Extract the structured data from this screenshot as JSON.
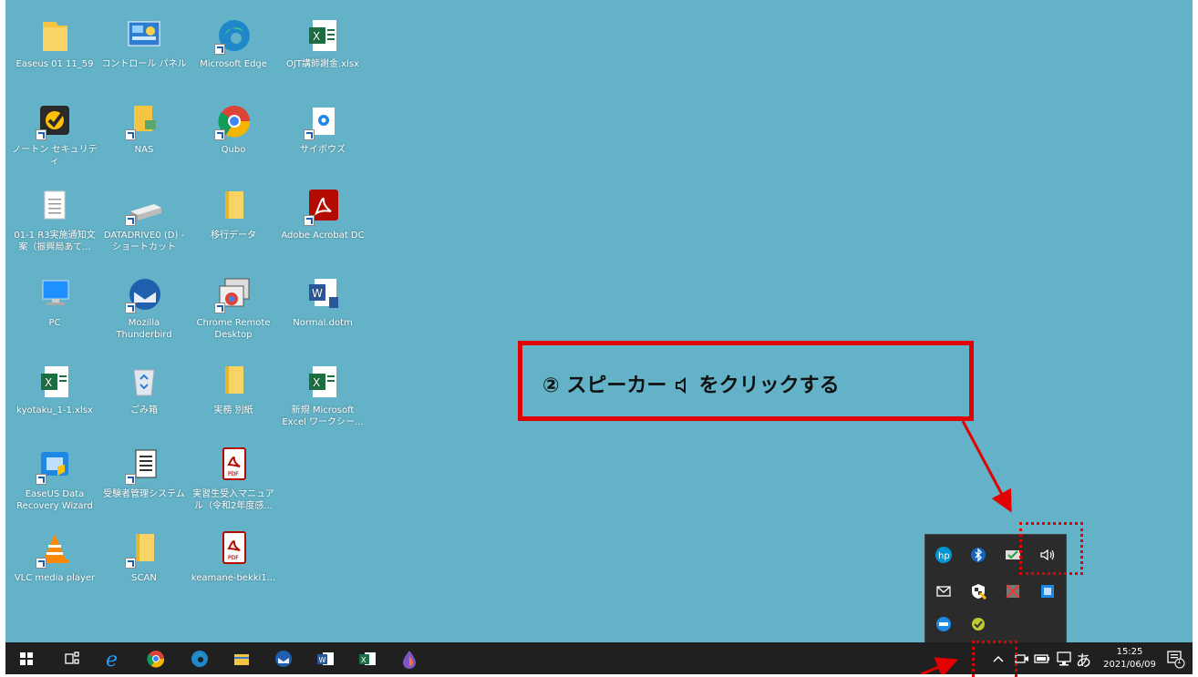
{
  "desktop": {
    "icons": [
      {
        "label": "Easeus 01 11_59"
      },
      {
        "label": "コントロール パネル"
      },
      {
        "label": "Microsoft Edge"
      },
      {
        "label": "OJT講師謝金.xlsx"
      },
      {
        "label": "ノートン セキュリティ"
      },
      {
        "label": "NAS"
      },
      {
        "label": "Qubo"
      },
      {
        "label": "サイボウズ"
      },
      {
        "label": "01-1 R3実施通知文案（振興局あて..."
      },
      {
        "label": "DATADRIVE0 (D) - ショートカット"
      },
      {
        "label": "移行データ"
      },
      {
        "label": "Adobe Acrobat DC"
      },
      {
        "label": "PC"
      },
      {
        "label": "Mozilla Thunderbird"
      },
      {
        "label": "Chrome Remote Desktop"
      },
      {
        "label": "Normal.dotm"
      },
      {
        "label": "kyotaku_1-1.xlsx"
      },
      {
        "label": "ごみ箱"
      },
      {
        "label": "実務 別紙"
      },
      {
        "label": "新規 Microsoft Excel ワークシー..."
      },
      {
        "label": "EaseUS Data Recovery Wizard"
      },
      {
        "label": "受験者管理システム"
      },
      {
        "label": "実習生受入マニュアル（令和2年度感..."
      },
      {
        "label": "VLC media player"
      },
      {
        "label": "SCAN"
      },
      {
        "label": "keamane-bekki1..."
      }
    ]
  },
  "callout": {
    "number": "②",
    "text": "スピーカー",
    "text2": "をクリックする"
  },
  "taskbar": {
    "time": "15:25",
    "date": "2021/06/09",
    "ime": "あ",
    "notification_count": "1"
  },
  "colors": {
    "desktop": "#63b2c7",
    "taskbar": "#202020",
    "highlight": "#e30000"
  }
}
